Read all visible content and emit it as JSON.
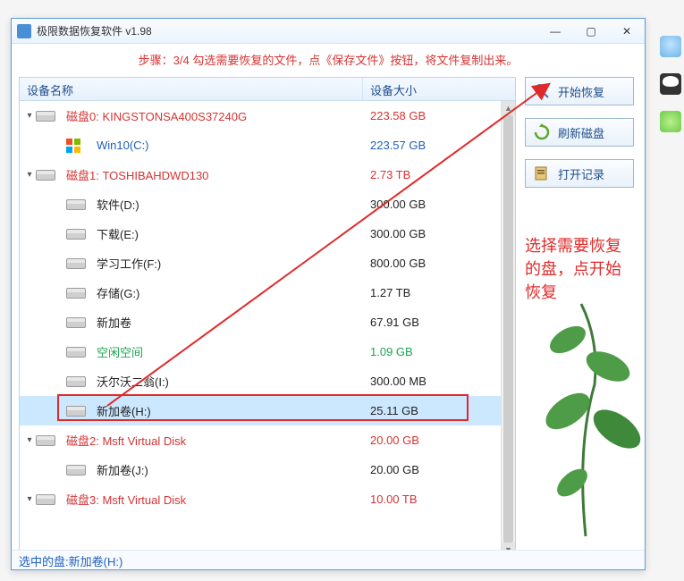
{
  "titlebar": {
    "title": "极限数据恢复软件 v1.98"
  },
  "instruction": "步骤：3/4 勾选需要恢复的文件，点《保存文件》按钮，将文件复制出来。",
  "columns": {
    "name": "设备名称",
    "size": "设备大小"
  },
  "rows": [
    {
      "chev": "▾",
      "indent": 0,
      "label": "磁盘0: KINGSTONSA400S37240G",
      "size": "223.58 GB",
      "color": "red",
      "icon": "drive"
    },
    {
      "chev": "",
      "indent": 1,
      "label": "Win10(C:)",
      "size": "223.57 GB",
      "color": "blue",
      "icon": "win"
    },
    {
      "chev": "▾",
      "indent": 0,
      "label": "磁盘1: TOSHIBAHDWD130",
      "size": "2.73 TB",
      "color": "red",
      "icon": "drive"
    },
    {
      "chev": "",
      "indent": 1,
      "label": "软件(D:)",
      "size": "300.00 GB",
      "color": "blk",
      "icon": "drive"
    },
    {
      "chev": "",
      "indent": 1,
      "label": "下载(E:)",
      "size": "300.00 GB",
      "color": "blk",
      "icon": "drive"
    },
    {
      "chev": "",
      "indent": 1,
      "label": "学习工作(F:)",
      "size": "800.00 GB",
      "color": "blk",
      "icon": "drive"
    },
    {
      "chev": "",
      "indent": 1,
      "label": "存储(G:)",
      "size": "1.27 TB",
      "color": "blk",
      "icon": "drive"
    },
    {
      "chev": "",
      "indent": 1,
      "label": "新加卷",
      "size": "67.91 GB",
      "color": "blk",
      "icon": "drive"
    },
    {
      "chev": "",
      "indent": 1,
      "label": "空闲空间",
      "size": "1.09 GB",
      "color": "green",
      "icon": "drive"
    },
    {
      "chev": "",
      "indent": 1,
      "label": "沃尔沃二翁(I:)",
      "size": "300.00 MB",
      "color": "blk",
      "icon": "drive"
    },
    {
      "chev": "",
      "indent": 1,
      "label": "新加卷(H:)",
      "size": "25.11 GB",
      "color": "blk",
      "icon": "drive",
      "selected": true
    },
    {
      "chev": "▾",
      "indent": 0,
      "label": "磁盘2: Msft    Virtual Disk",
      "size": "20.00 GB",
      "color": "red",
      "icon": "drive"
    },
    {
      "chev": "",
      "indent": 1,
      "label": "新加卷(J:)",
      "size": "20.00 GB",
      "color": "blk",
      "icon": "drive"
    },
    {
      "chev": "▾",
      "indent": 0,
      "label": "磁盘3: Msft    Virtual Disk",
      "size": "10.00 TB",
      "color": "red",
      "icon": "drive"
    }
  ],
  "buttons": {
    "start": "开始恢复",
    "refresh": "刷新磁盘",
    "openlog": "打开记录"
  },
  "annotation": "选择需要恢复的盘，点开始恢复",
  "status": "选中的盘:新加卷(H:)"
}
